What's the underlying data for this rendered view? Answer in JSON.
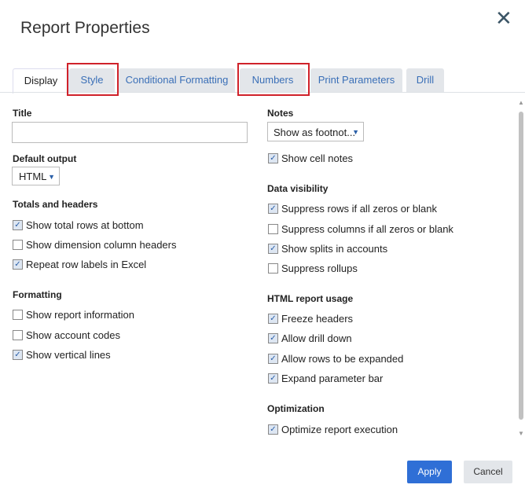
{
  "dialog": {
    "title": "Report Properties",
    "close_icon": "close-icon"
  },
  "tabs": [
    {
      "label": "Display",
      "active": true
    },
    {
      "label": "Style"
    },
    {
      "label": "Conditional Formatting"
    },
    {
      "label": "Numbers"
    },
    {
      "label": "Print Parameters"
    },
    {
      "label": "Drill"
    }
  ],
  "left": {
    "title_label": "Title",
    "title_value": "",
    "default_output_label": "Default output",
    "default_output_value": "HTML",
    "totals_label": "Totals and headers",
    "totals": [
      {
        "label": "Show total rows at bottom",
        "checked": true
      },
      {
        "label": "Show dimension column headers",
        "checked": false
      },
      {
        "label": "Repeat row labels in Excel",
        "checked": true
      }
    ],
    "formatting_label": "Formatting",
    "formatting": [
      {
        "label": "Show report information",
        "checked": false
      },
      {
        "label": "Show account codes",
        "checked": false
      },
      {
        "label": "Show vertical lines",
        "checked": true
      }
    ]
  },
  "right": {
    "notes_label": "Notes",
    "notes_value": "Show as footnot...",
    "show_cell_notes": {
      "label": "Show cell notes",
      "checked": true
    },
    "visibility_label": "Data visibility",
    "visibility": [
      {
        "label": "Suppress rows if all zeros or blank",
        "checked": true
      },
      {
        "label": "Suppress columns if all zeros or blank",
        "checked": false
      },
      {
        "label": "Show splits in accounts",
        "checked": true
      },
      {
        "label": "Suppress rollups",
        "checked": false
      }
    ],
    "html_label": "HTML report usage",
    "html": [
      {
        "label": "Freeze headers",
        "checked": true
      },
      {
        "label": "Allow drill down",
        "checked": true
      },
      {
        "label": "Allow rows to be expanded",
        "checked": true
      },
      {
        "label": "Expand parameter bar",
        "checked": true
      }
    ],
    "optimization_label": "Optimization",
    "optimization": [
      {
        "label": "Optimize report execution",
        "checked": true
      }
    ]
  },
  "buttons": {
    "apply": "Apply",
    "cancel": "Cancel"
  },
  "colors": {
    "accent": "#2f6fd6",
    "highlight": "#d0222a"
  }
}
